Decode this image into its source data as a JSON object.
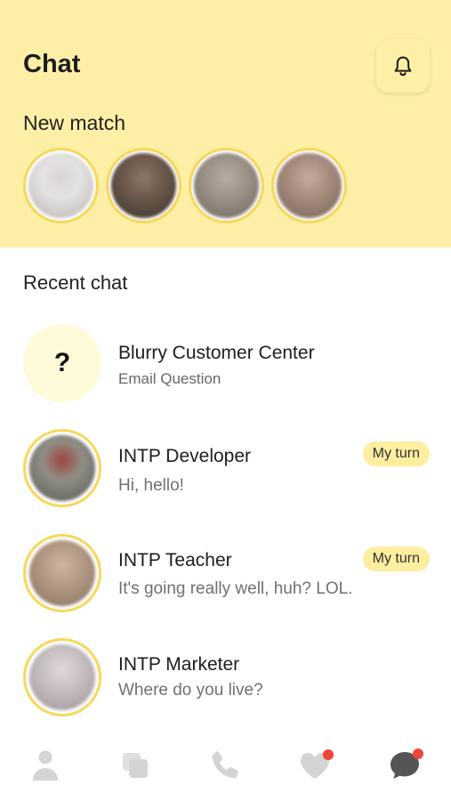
{
  "header": {
    "title": "Chat",
    "bell_icon": "bell-icon"
  },
  "new_match": {
    "label": "New match",
    "avatars": [
      {
        "colors": [
          "#e4e2e2",
          "#b9b3b0",
          "#d9d4d1"
        ]
      },
      {
        "colors": [
          "#6d5a4c",
          "#3c3029",
          "#8b7868"
        ]
      },
      {
        "colors": [
          "#9d9389",
          "#6f665e",
          "#b8ada2"
        ]
      },
      {
        "colors": [
          "#a78d7e",
          "#776357",
          "#c4ad9f"
        ]
      }
    ]
  },
  "recent": {
    "label": "Recent chat",
    "items": [
      {
        "name": "Blurry Customer Center",
        "subtitle": "Email Question",
        "avatar_text": "?"
      },
      {
        "name": "INTP Developer",
        "message": "Hi, hello!",
        "badge": "My turn",
        "colors": [
          "#8f8e86",
          "#5c5a54",
          "#a2433e"
        ]
      },
      {
        "name": "INTP Teacher",
        "message": "It's going really well, huh? LOL.",
        "badge": "My turn",
        "colors": [
          "#b39a85",
          "#8a7260",
          "#cdb8a2"
        ]
      },
      {
        "name": "INTP Marketer",
        "message": "Where do you live?",
        "colors": [
          "#c8bfc2",
          "#9f9497",
          "#e0d8da"
        ]
      }
    ]
  },
  "tabbar": {
    "items": [
      {
        "icon": "person-icon",
        "active": false,
        "badge": false
      },
      {
        "icon": "cards-icon",
        "active": false,
        "badge": false
      },
      {
        "icon": "phone-icon",
        "active": false,
        "badge": false
      },
      {
        "icon": "heart-icon",
        "active": false,
        "badge": true
      },
      {
        "icon": "chat-icon",
        "active": true,
        "badge": true
      }
    ],
    "inactive_color": "#d4d4d4",
    "active_color": "#555555",
    "badge_color": "#f04438"
  },
  "colors": {
    "header_bg": "#fdf0a6",
    "accent_ring": "#f6d85b",
    "badge_bg": "#fdeea0"
  }
}
